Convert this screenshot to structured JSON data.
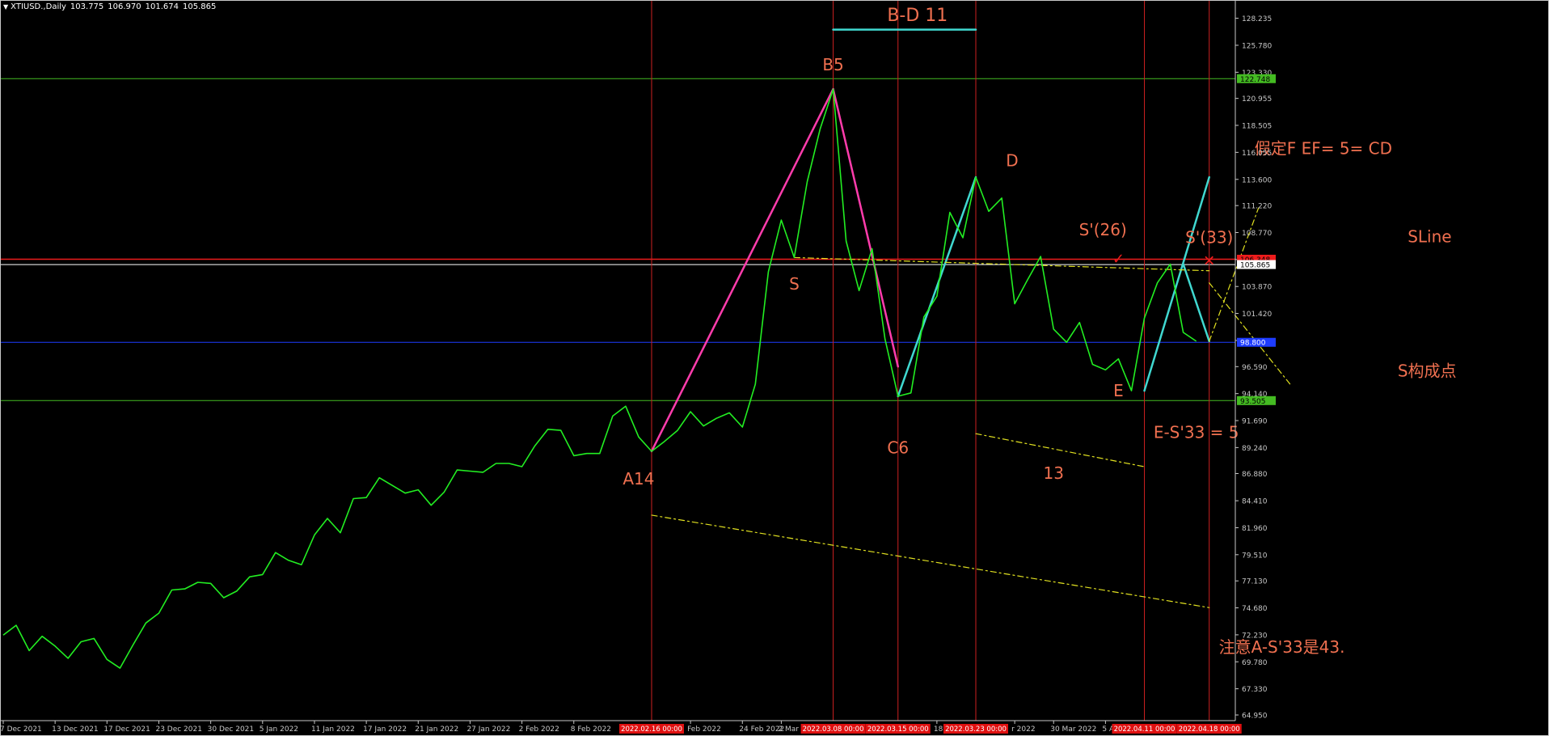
{
  "header": {
    "symbol": "XTIUSD.,Daily",
    "open": "103.775",
    "high": "106.970",
    "low": "101.674",
    "close": "105.865"
  },
  "chart_data": {
    "type": "line",
    "ylim": [
      64.95,
      129.6
    ],
    "grid": false,
    "y_tick_labels": [
      "128.235",
      "125.780",
      "123.330",
      "120.955",
      "118.505",
      "116.055",
      "113.600",
      "111.220",
      "108.770",
      "106.320",
      "103.870",
      "101.420",
      "98.970",
      "96.590",
      "94.140",
      "91.690",
      "89.240",
      "86.880",
      "84.410",
      "81.960",
      "79.510",
      "77.130",
      "74.680",
      "72.230",
      "69.780",
      "67.330",
      "64.950"
    ],
    "y_tick_values": [
      128.235,
      125.78,
      123.33,
      120.955,
      118.505,
      116.055,
      113.6,
      111.22,
      108.77,
      106.32,
      103.87,
      101.42,
      98.97,
      96.59,
      94.14,
      91.69,
      89.24,
      86.88,
      84.41,
      81.96,
      79.51,
      77.13,
      74.68,
      72.23,
      69.78,
      67.33,
      64.95
    ],
    "x_tick_labels": [
      {
        "label": "7 Dec 2021",
        "index": 0
      },
      {
        "label": "13 Dec 2021",
        "index": 4
      },
      {
        "label": "17 Dec 2021",
        "index": 8
      },
      {
        "label": "23 Dec 2021",
        "index": 12
      },
      {
        "label": "30 Dec 2021",
        "index": 16
      },
      {
        "label": "5 Jan 2022",
        "index": 20
      },
      {
        "label": "11 Jan 2022",
        "index": 24
      },
      {
        "label": "17 Jan 2022",
        "index": 28
      },
      {
        "label": "21 Jan 2022",
        "index": 32
      },
      {
        "label": "27 Jan 2022",
        "index": 36
      },
      {
        "label": "2 Feb 2022",
        "index": 40
      },
      {
        "label": "8 Feb 2022",
        "index": 44
      },
      {
        "label": "Feb 2022",
        "index": 53
      },
      {
        "label": "24 Feb 2022",
        "index": 57
      },
      {
        "label": "2 Mar",
        "index": 60
      },
      {
        "label": "18",
        "index": 72
      },
      {
        "label": "r 2022",
        "index": 78
      },
      {
        "label": "30 Mar 2022",
        "index": 81
      },
      {
        "label": "5 Apr",
        "index": 85
      }
    ],
    "x_tick_highlights": [
      {
        "label": "2022.02.16 00:00",
        "index": 50
      },
      {
        "label": "2022.03.08 00:00",
        "index": 64
      },
      {
        "label": "2022.03.15 00:00",
        "index": 69
      },
      {
        "label": "2022.03.23 00:00",
        "index": 75
      },
      {
        "label": "2022.04.11 00:00",
        "index": 88
      },
      {
        "label": "2022.04.18 00:00",
        "index": 93
      }
    ],
    "series": [
      {
        "color": "#22ee22",
        "values": [
          72.2,
          73.1,
          70.8,
          72.1,
          71.2,
          70.1,
          71.6,
          71.9,
          70.0,
          69.2,
          71.3,
          73.3,
          74.2,
          76.3,
          76.4,
          77.0,
          76.9,
          75.6,
          76.2,
          77.5,
          77.7,
          79.7,
          79.0,
          78.6,
          81.3,
          82.8,
          81.5,
          84.6,
          84.7,
          86.5,
          85.8,
          85.1,
          85.4,
          84.0,
          85.2,
          87.2,
          87.1,
          87.0,
          87.8,
          87.8,
          87.5,
          89.4,
          90.9,
          90.8,
          88.5,
          88.7,
          88.7,
          92.1,
          93.0,
          90.2,
          88.9,
          89.8,
          90.8,
          92.5,
          91.2,
          91.9,
          92.4,
          91.1,
          95.0,
          105.2,
          109.9,
          106.5,
          113.4,
          118.2,
          121.8,
          108.0,
          103.5,
          107.3,
          99.1,
          93.9,
          94.2,
          101.1,
          103.0,
          110.6,
          108.3,
          113.8,
          110.7,
          111.9,
          102.3,
          104.5,
          106.6,
          100.0,
          98.8,
          100.6,
          96.8,
          96.3,
          97.3,
          94.4,
          101.0,
          104.2,
          105.9,
          99.7,
          98.9
        ]
      }
    ],
    "horizontal_lines": [
      {
        "value": 122.748,
        "color": "#44bb22",
        "label": "122.748"
      },
      {
        "value": 106.348,
        "color": "#ee1c1c",
        "label": "106.348"
      },
      {
        "value": 105.865,
        "color": "#ffffff",
        "label": "105.865"
      },
      {
        "value": 98.8,
        "color": "#1e3cff",
        "label": "98.800"
      },
      {
        "value": 93.505,
        "color": "#44bb22",
        "label": "93.505"
      }
    ],
    "vertical_lines": [
      50,
      64,
      69,
      75,
      88,
      93
    ],
    "trend_lines": [
      {
        "color": "#ff3cac",
        "width": 2.5,
        "dash": "",
        "points": [
          [
            50,
            88.9
          ],
          [
            64,
            121.8
          ]
        ]
      },
      {
        "color": "#ff3cac",
        "width": 2.5,
        "dash": "",
        "points": [
          [
            64,
            121.8
          ],
          [
            69,
            96.6
          ]
        ]
      },
      {
        "color": "#40d8d0",
        "width": 2.5,
        "dash": "",
        "points": [
          [
            69,
            93.9
          ],
          [
            75,
            113.8
          ]
        ]
      },
      {
        "color": "#40d8d0",
        "width": 2.5,
        "dash": "",
        "points": [
          [
            88,
            94.4
          ],
          [
            93,
            113.8
          ]
        ]
      },
      {
        "color": "#40d8d0",
        "width": 2.5,
        "dash": "",
        "points": [
          [
            91,
            105.9
          ],
          [
            93,
            98.9
          ]
        ]
      },
      {
        "color": "#40d8d0",
        "width": 2.5,
        "dash": "",
        "points": [
          [
            64,
            127.2
          ],
          [
            75,
            127.2
          ]
        ]
      },
      {
        "color": "#e0e020",
        "width": 1.2,
        "dash": "7,4,2,4",
        "points": [
          [
            61,
            106.5
          ],
          [
            93,
            105.3
          ]
        ]
      },
      {
        "color": "#e0e020",
        "width": 1.2,
        "dash": "7,4,2,4",
        "points": [
          [
            50,
            83.1
          ],
          [
            93,
            74.7
          ]
        ]
      },
      {
        "color": "#e0e020",
        "width": 1.2,
        "dash": "7,4,2,4",
        "points": [
          [
            75,
            90.5
          ],
          [
            88,
            87.5
          ]
        ]
      },
      {
        "color": "#e0e020",
        "width": 1.2,
        "dash": "7,4,2,4",
        "points": [
          [
            93,
            98.9
          ],
          [
            96.8,
            111
          ]
        ]
      },
      {
        "color": "#e0e020",
        "width": 1.2,
        "dash": "7,4,2,4",
        "points": [
          [
            93,
            104.2
          ],
          [
            99.3,
            94.9
          ]
        ]
      }
    ],
    "annotations": [
      {
        "text": "B-D 11",
        "x": 70.5,
        "y": 128.0,
        "size": 22
      },
      {
        "text": "B5",
        "x": 64,
        "y": 123.5,
        "size": 20
      },
      {
        "text": "D",
        "x": 77.8,
        "y": 114.8,
        "size": 20
      },
      {
        "text": "S'(26)",
        "x": 84.8,
        "y": 108.5,
        "size": 20
      },
      {
        "text": "S'(33)",
        "x": 93,
        "y": 107.8,
        "size": 20
      },
      {
        "text": "假定F  EF= 5= CD",
        "x": 101.8,
        "y": 115.9,
        "size": 20
      },
      {
        "text": "SLine",
        "x": 110,
        "y": 107.9,
        "size": 20
      },
      {
        "text": "S",
        "x": 61,
        "y": 103.6,
        "size": 20
      },
      {
        "text": "S构成点",
        "x": 109.8,
        "y": 95.7,
        "size": 20
      },
      {
        "text": "E",
        "x": 86,
        "y": 93.9,
        "size": 20
      },
      {
        "text": "C6",
        "x": 69,
        "y": 88.7,
        "size": 20
      },
      {
        "text": "E-S'33 = 5",
        "x": 92,
        "y": 90.1,
        "size": 20
      },
      {
        "text": "A14",
        "x": 49,
        "y": 85.9,
        "size": 20
      },
      {
        "text": "13",
        "x": 81,
        "y": 86.4,
        "size": 20
      },
      {
        "text": "注意A-S'33是43.",
        "x": 98.6,
        "y": 70.6,
        "size": 20
      }
    ],
    "markers": [
      {
        "x": 86,
        "y": 106.4,
        "color": "#ee1c1c",
        "symbol": "✓"
      },
      {
        "x": 93,
        "y": 106.2,
        "color": "#ee1c1c",
        "symbol": "✕"
      }
    ]
  }
}
